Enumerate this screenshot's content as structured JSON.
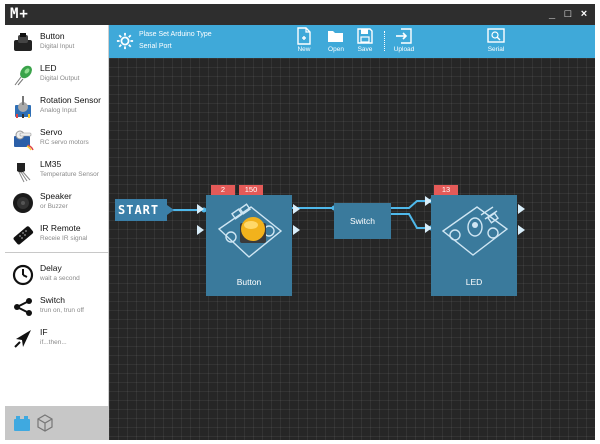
{
  "app": {
    "logo": "M+"
  },
  "window": {
    "minimize": "_",
    "maximize": "□",
    "close": "×"
  },
  "toolbar": {
    "line1": "Plase Set Arduino Type",
    "line2": "Serial Port",
    "buttons": {
      "new": "New",
      "open": "Open",
      "save": "Save",
      "upload": "Upload",
      "serial": "Serial"
    }
  },
  "sidebar": {
    "items": [
      {
        "name": "Button",
        "desc": "Digital Input",
        "icon": "button-icon"
      },
      {
        "name": "LED",
        "desc": "Digital Output",
        "icon": "led-icon"
      },
      {
        "name": "Rotation Sensor",
        "desc": "Analog Input",
        "icon": "rotation-sensor-icon"
      },
      {
        "name": "Servo",
        "desc": "RC servo motors",
        "icon": "servo-icon"
      },
      {
        "name": "LM35",
        "desc": "Temperature Sensor",
        "icon": "lm35-icon"
      },
      {
        "name": "Speaker",
        "desc": "or Buzzer",
        "icon": "speaker-icon"
      },
      {
        "name": "IR Remote",
        "desc": "Receie IR signal",
        "icon": "ir-remote-icon"
      },
      {
        "name": "Delay",
        "desc": "wait a second",
        "icon": "clock-icon"
      },
      {
        "name": "Switch",
        "desc": "trun on, trun off",
        "icon": "switch-icon"
      },
      {
        "name": "IF",
        "desc": "if...then...",
        "icon": "if-icon"
      }
    ],
    "bottom_icons": [
      "blocks-icon",
      "cube-icon"
    ]
  },
  "canvas": {
    "start_label": "START",
    "nodes": {
      "button": {
        "label": "Button",
        "tags": [
          "2",
          "150"
        ]
      },
      "switch": {
        "label": "Switch"
      },
      "led": {
        "label": "LED",
        "tags": [
          "13"
        ]
      }
    }
  },
  "colors": {
    "toolbar": "#3fa9d9",
    "node": "#3a7a9c",
    "tag": "#e45a58",
    "wire": "#4fb8ea",
    "canvas": "#262626"
  }
}
